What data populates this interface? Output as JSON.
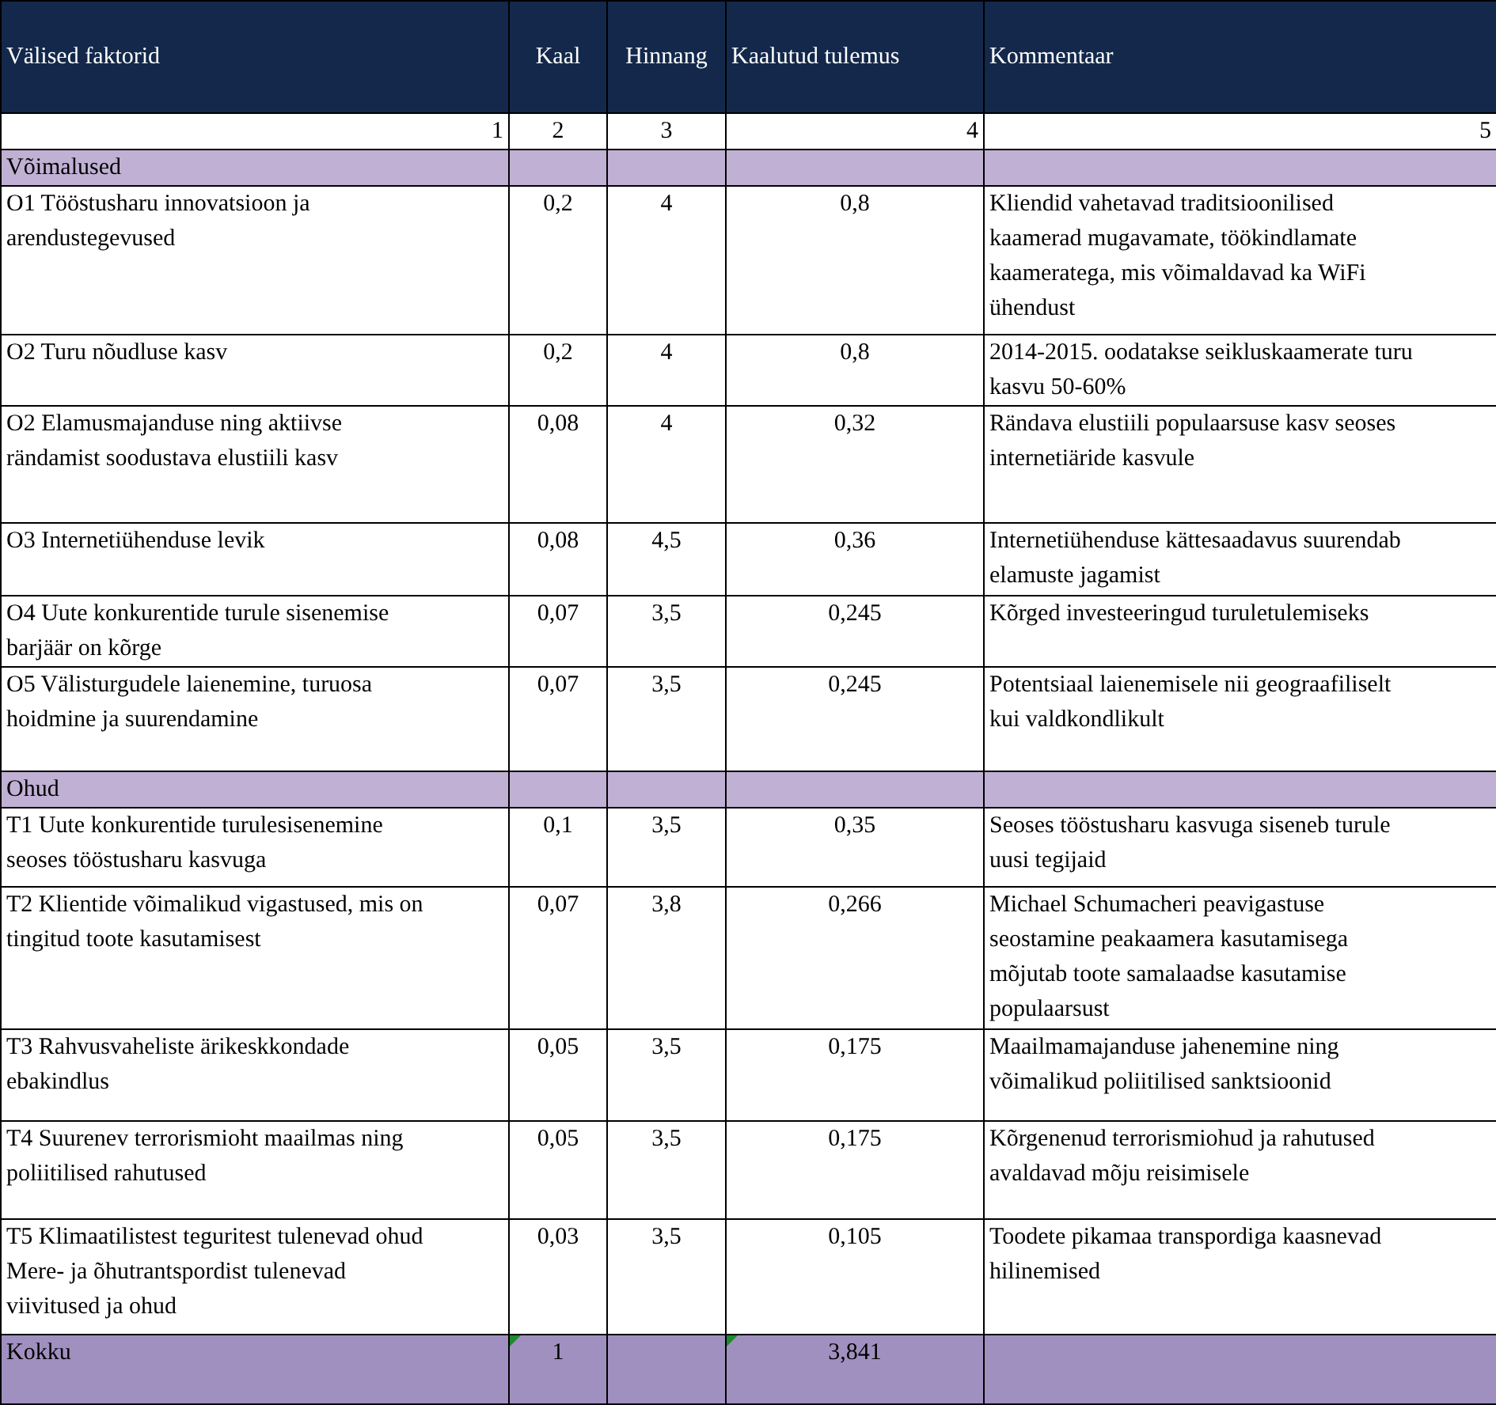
{
  "table": {
    "columns": [
      "Välised faktorid",
      "Kaal",
      "Hinnang",
      "Kaalutud tulemus",
      "Kommentaar"
    ],
    "column_numbers": [
      "1",
      "2",
      "3",
      "4",
      "5"
    ],
    "sections": [
      {
        "title": "Võimalused",
        "rows": [
          {
            "factor": "O1 Tööstusharu innovatsioon ja\narendustegevused",
            "weight": "0,2",
            "rating": "4",
            "weighted": "0,8",
            "comment": "Kliendid vahetavad traditsioonilised\nkaamerad mugavamate, töökindlamate\nkaameratega, mis võimaldavad ka WiFi\nühendust"
          },
          {
            "factor": "O2 Turu nõudluse kasv",
            "weight": "0,2",
            "rating": "4",
            "weighted": "0,8",
            "comment": "2014-2015. oodatakse seikluskaamerate turu\nkasvu 50-60%"
          },
          {
            "factor": "O2 Elamusmajanduse ning aktiivse\nrändamist soodustava elustiili kasv",
            "weight": "0,08",
            "rating": "4",
            "weighted": "0,32",
            "comment": "Rändava elustiili populaarsuse kasv seoses\ninternetiäride kasvule"
          },
          {
            "factor": "O3 Internetiühenduse levik",
            "weight": "0,08",
            "rating": "4,5",
            "weighted": "0,36",
            "comment": "Internetiühenduse kättesaadavus suurendab\nelamuste jagamist"
          },
          {
            "factor": "O4 Uute konkurentide turule sisenemise\nbarjäär on kõrge",
            "weight": "0,07",
            "rating": "3,5",
            "weighted": "0,245",
            "comment": "Kõrged investeeringud turuletulemiseks"
          },
          {
            "factor": "O5 Välisturgudele laienemine, turuosa\nhoidmine ja suurendamine",
            "weight": "0,07",
            "rating": "3,5",
            "weighted": "0,245",
            "comment": "Potentsiaal laienemisele nii geograafiliselt\nkui valdkondlikult"
          }
        ]
      },
      {
        "title": "Ohud",
        "rows": [
          {
            "factor": "T1 Uute konkurentide turulesisenemine\nseoses tööstusharu kasvuga",
            "weight": "0,1",
            "rating": "3,5",
            "weighted": "0,35",
            "comment": "Seoses tööstusharu kasvuga siseneb turule\nuusi tegijaid"
          },
          {
            "factor": "T2 Klientide võimalikud vigastused, mis on\ntingitud toote kasutamisest",
            "weight": "0,07",
            "rating": "3,8",
            "weighted": "0,266",
            "comment": "Michael Schumacheri peavigastuse\nseostamine peakaamera kasutamisega\nmõjutab toote samalaadse kasutamise\npopulaarsust"
          },
          {
            "factor": "T3 Rahvusvaheliste ärikeskkondade\nebakindlus",
            "weight": "0,05",
            "rating": "3,5",
            "weighted": "0,175",
            "comment": "Maailmamajanduse jahenemine ning\nvõimalikud poliitilised sanktsioonid"
          },
          {
            "factor": "T4 Suurenev terrorismioht maailmas ning\npoliitilised rahutused",
            "weight": "0,05",
            "rating": "3,5",
            "weighted": "0,175",
            "comment": "Kõrgenenud terrorismiohud ja rahutused\navaldavad mõju reisimisele"
          },
          {
            "factor": "T5 Klimaatilistest teguritest tulenevad ohud\nMere- ja õhutrantspordist tulenevad\nviivitused ja ohud",
            "weight": "0,03",
            "rating": "3,5",
            "weighted": "0,105",
            "comment": "Toodete pikamaa transpordiga kaasnevad\nhilinemised"
          }
        ]
      }
    ],
    "total": {
      "label": "Kokku",
      "weight": "1",
      "weight_flagged": true,
      "weighted": "3,841",
      "weighted_flagged": true
    }
  }
}
